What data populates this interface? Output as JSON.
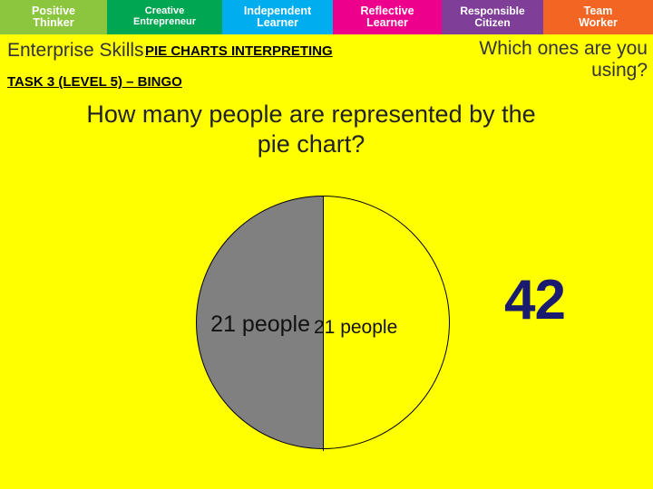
{
  "skillbar": {
    "items": [
      {
        "line1": "Positive",
        "line2": "Thinker",
        "color": "#8CC63E"
      },
      {
        "line1": "Creative",
        "line2": "Entrepreneur",
        "color": "#00A651"
      },
      {
        "line1": "Independent",
        "line2": "Learner",
        "color": "#00AEEF"
      },
      {
        "line1": "Reflective",
        "line2": "Learner",
        "color": "#EC008C"
      },
      {
        "line1": "Responsible",
        "line2": "Citizen",
        "color": "#7F3F98"
      },
      {
        "line1": "Team",
        "line2": "Worker",
        "color": "#F26522"
      }
    ]
  },
  "header": {
    "enterprise_skills": "Enterprise Skills",
    "pie_charts_title": "PIE CHARTS INTERPRETING",
    "which_ones_line1": "Which ones are you",
    "which_ones_line2": "using?",
    "task_line": "TASK 3 (LEVEL 5) – BINGO"
  },
  "question": {
    "line1": "How many people are represented by the",
    "line2": "pie chart?"
  },
  "chart": {
    "type": "pie",
    "slice_label_left": "21 people",
    "slice_label_right": "21 people",
    "slices": [
      {
        "label": "21 people",
        "value": 21,
        "color": "#808080",
        "share": 50
      },
      {
        "label": "21 people",
        "value": 21,
        "color": "#FFFF00",
        "share": 50
      }
    ]
  },
  "answer": {
    "value": "42"
  }
}
